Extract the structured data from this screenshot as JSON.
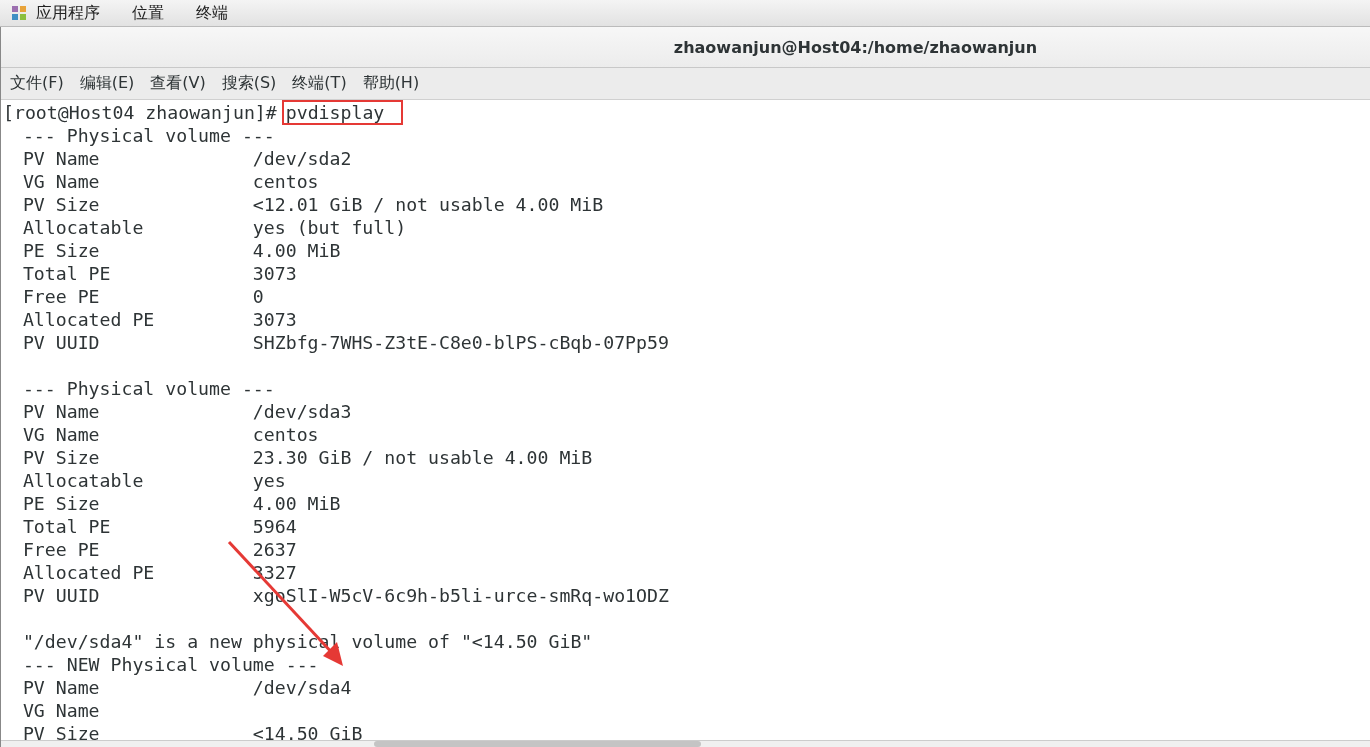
{
  "top_bar": {
    "items": [
      "应用程序",
      "位置",
      "终端"
    ]
  },
  "window": {
    "title": "zhaowanjun@Host04:/home/zhaowanjun"
  },
  "menu": [
    "文件(F)",
    "编辑(E)",
    "查看(V)",
    "搜索(S)",
    "终端(T)",
    "帮助(H)"
  ],
  "terminal": {
    "lines": [
      {
        "kind": "prompt",
        "prompt": "[root@Host04 zhaowanjun]#",
        "command": "pvdisplay",
        "highlighted": true
      },
      {
        "kind": "text",
        "text": "--- Physical volume ---"
      },
      {
        "kind": "field",
        "label": "PV Name",
        "value": "/dev/sda2"
      },
      {
        "kind": "field",
        "label": "VG Name",
        "value": "centos"
      },
      {
        "kind": "field",
        "label": "PV Size",
        "value": "<12.01 GiB / not usable 4.00 MiB"
      },
      {
        "kind": "field",
        "label": "Allocatable",
        "value": "yes (but full)"
      },
      {
        "kind": "field",
        "label": "PE Size",
        "value": "4.00 MiB"
      },
      {
        "kind": "field",
        "label": "Total PE",
        "value": "3073"
      },
      {
        "kind": "field",
        "label": "Free PE",
        "value": "0"
      },
      {
        "kind": "field",
        "label": "Allocated PE",
        "value": "3073"
      },
      {
        "kind": "field",
        "label": "PV UUID",
        "value": "SHZbfg-7WHS-Z3tE-C8e0-blPS-cBqb-07Pp59"
      },
      {
        "kind": "blank"
      },
      {
        "kind": "text",
        "text": "--- Physical volume ---"
      },
      {
        "kind": "field",
        "label": "PV Name",
        "value": "/dev/sda3"
      },
      {
        "kind": "field",
        "label": "VG Name",
        "value": "centos"
      },
      {
        "kind": "field",
        "label": "PV Size",
        "value": "23.30 GiB / not usable 4.00 MiB"
      },
      {
        "kind": "field",
        "label": "Allocatable",
        "value": "yes"
      },
      {
        "kind": "field",
        "label": "PE Size",
        "value": "4.00 MiB"
      },
      {
        "kind": "field",
        "label": "Total PE",
        "value": "5964"
      },
      {
        "kind": "field",
        "label": "Free PE",
        "value": "2637"
      },
      {
        "kind": "field",
        "label": "Allocated PE",
        "value": "3327"
      },
      {
        "kind": "field",
        "label": "PV UUID",
        "value": "xgoSlI-W5cV-6c9h-b5li-urce-smRq-wo1ODZ"
      },
      {
        "kind": "blank"
      },
      {
        "kind": "text",
        "text": "\"/dev/sda4\" is a new physical volume of \"<14.50 GiB\""
      },
      {
        "kind": "text",
        "text": "--- NEW Physical volume ---"
      },
      {
        "kind": "field",
        "label": "PV Name",
        "value": "/dev/sda4"
      },
      {
        "kind": "field",
        "label": "VG Name"
      },
      {
        "kind": "field",
        "label": "PV Size",
        "value": "<14.50 GiB"
      }
    ]
  }
}
